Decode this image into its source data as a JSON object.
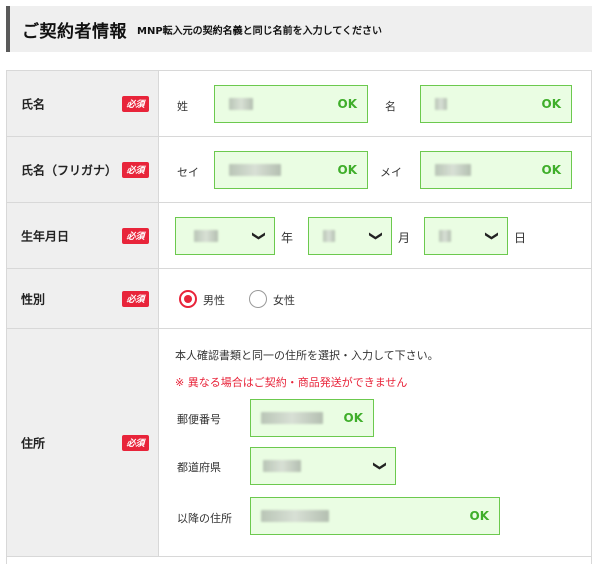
{
  "section": {
    "title": "ご契約者情報",
    "subtitle": "MNP転入元の契約名義と同じ名前を入力してください"
  },
  "required_badge": "必須",
  "ok_label": "OK",
  "colors": {
    "required_red": "#e8243a",
    "ok_green": "#3fae2a",
    "input_bg": "#eafde3",
    "input_border": "#6cc94e"
  },
  "rows": {
    "name": {
      "label": "氏名",
      "last_name_label": "姓",
      "first_name_label": "名"
    },
    "kana": {
      "label": "氏名（フリガナ）",
      "last_kana_label": "セイ",
      "first_kana_label": "メイ"
    },
    "birth": {
      "label": "生年月日",
      "year_unit": "年",
      "month_unit": "月",
      "day_unit": "日"
    },
    "gender": {
      "label": "性別",
      "options": [
        "男性",
        "女性"
      ],
      "selected": "男性"
    },
    "address": {
      "label": "住所",
      "note": "本人確認書類と同一の住所を選択・入力して下さい。",
      "warning": "※ 異なる場合はご契約・商品発送ができません",
      "postal_label": "郵便番号",
      "prefecture_label": "都道府県",
      "rest_label": "以降の住所"
    }
  }
}
